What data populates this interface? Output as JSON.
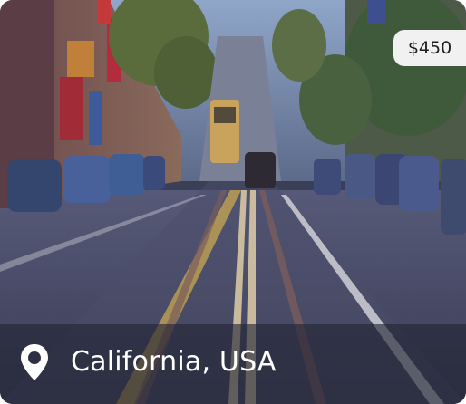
{
  "listing": {
    "price": "$450",
    "location": "California, USA"
  },
  "icons": {
    "location": "map-pin-icon"
  },
  "colors": {
    "badge_bg": "#f1f1f1",
    "overlay": "#222434",
    "label_text": "#ffffff"
  }
}
